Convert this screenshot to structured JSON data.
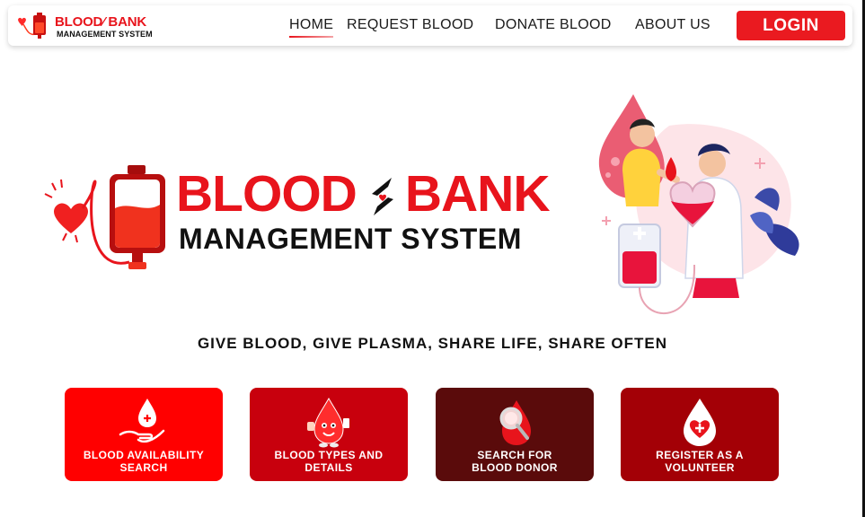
{
  "colors": {
    "brand_red": "#e8141c",
    "card_1": "#ff0000",
    "card_2": "#c8000d",
    "card_3": "#5a0b0b",
    "card_4": "#a30006"
  },
  "navbar": {
    "logo_line1": "BLOOD⁄ BANK",
    "logo_line2": "MANAGEMENT SYSTEM",
    "links": {
      "home": "HOME",
      "request": "REQUEST BLOOD",
      "donate": "DONATE BLOOD",
      "about": "ABOUT US"
    },
    "login_label": "LOGIN"
  },
  "hero": {
    "title_word1": "BLOOD",
    "title_word2": "BANK",
    "subtitle": "MANAGEMENT SYSTEM",
    "tagline": "GIVE BLOOD, GIVE PLASMA, SHARE LIFE, SHARE OFTEN"
  },
  "icons": {
    "nav_logo": "blood-bag-heart-icon",
    "hero_logo": "blood-bag-heart-icon",
    "illustration": "doctor-donor-illustration",
    "card_1": "hand-blood-drop-icon",
    "card_2": "blood-drop-mascot-icon",
    "card_3": "magnifier-blood-drop-icon",
    "card_4": "heart-cross-drop-icon"
  },
  "cards": [
    {
      "label_line1": "BLOOD AVAILABILITY",
      "label_line2": "SEARCH"
    },
    {
      "label_line1": "BLOOD TYPES AND",
      "label_line2": "DETAILS"
    },
    {
      "label_line1": "SEARCH FOR",
      "label_line2": "BLOOD DONOR"
    },
    {
      "label_line1": "REGISTER AS A",
      "label_line2": "VOLUNTEER"
    }
  ]
}
